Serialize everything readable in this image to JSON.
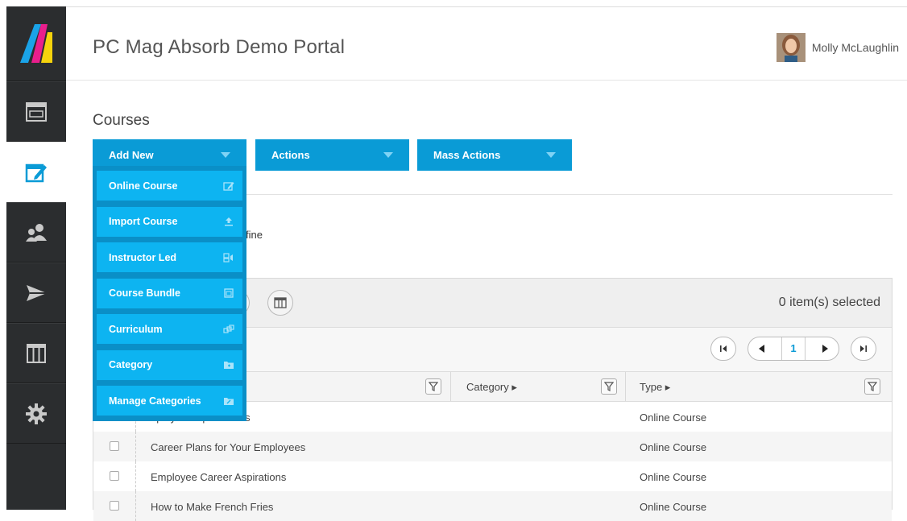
{
  "header": {
    "portal_title": "PC Mag Absorb Demo Portal",
    "user_name": "Molly McLaughlin"
  },
  "sidebar": {
    "items": [
      {
        "icon": "dashboard-icon"
      },
      {
        "icon": "courses-edit-icon",
        "active": true
      },
      {
        "icon": "users-icon"
      },
      {
        "icon": "send-icon"
      },
      {
        "icon": "columns-icon"
      },
      {
        "icon": "gear-icon"
      }
    ]
  },
  "page": {
    "title": "Courses",
    "refine_fragment": "fine"
  },
  "toolbar": {
    "add_new": "Add New",
    "actions": "Actions",
    "mass_actions": "Mass Actions"
  },
  "add_menu": {
    "items": [
      {
        "label": "Online Course",
        "icon": "edit-icon"
      },
      {
        "label": "Import Course",
        "icon": "upload-icon"
      },
      {
        "label": "Instructor Led",
        "icon": "instructor-icon"
      },
      {
        "label": "Course Bundle",
        "icon": "bundle-icon"
      },
      {
        "label": "Curriculum",
        "icon": "curriculum-icon"
      },
      {
        "label": "Category",
        "icon": "folder-icon"
      },
      {
        "label": "Manage Categories",
        "icon": "folder-icon"
      }
    ]
  },
  "grid": {
    "selected_count": "0 item(s) selected",
    "pager": {
      "current_page": "1"
    },
    "columns": {
      "category": "Category ▸",
      "type": "Type ▸"
    },
    "rows": [
      {
        "title": "nployee Expectations",
        "type": "Online Course"
      },
      {
        "title": "Career Plans for Your Employees",
        "type": "Online Course"
      },
      {
        "title": "Employee Career Aspirations",
        "type": "Online Course"
      },
      {
        "title": "How to Make French Fries",
        "type": "Online Course"
      }
    ]
  },
  "colors": {
    "accent": "#0a9bd6",
    "menu_item": "#0db4f1",
    "sidebar": "#2b2d2f"
  }
}
